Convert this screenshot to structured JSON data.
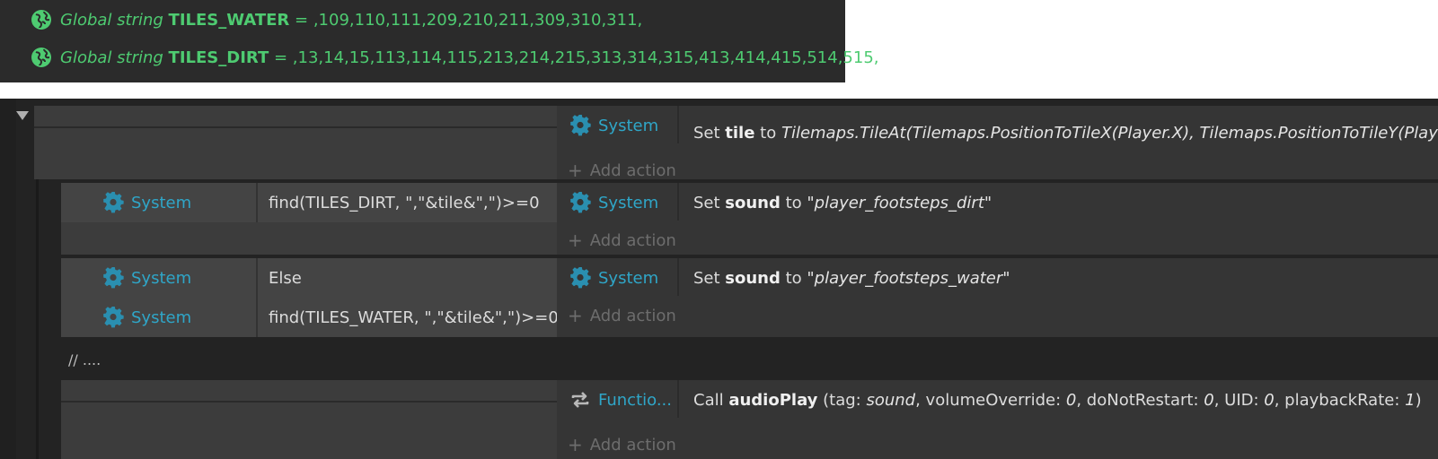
{
  "globals": [
    {
      "kind": "Global string",
      "name": "TILES_WATER",
      "op": "=",
      "value": ",109,110,111,209,210,211,309,310,311,"
    },
    {
      "kind": "Global string",
      "name": "TILES_DIRT",
      "op": "=",
      "value": ",13,14,15,113,114,115,213,214,215,313,314,315,413,414,415,514,515,"
    }
  ],
  "event1": {
    "action": {
      "object": "System",
      "pre": "Set ",
      "var": "tile",
      "mid": " to ",
      "expr": "Tilemaps.TileAt(Tilemaps.PositionToTileX(Player.X), Tilemaps.PositionToTileY(Player.Y))"
    },
    "add_action": "Add action"
  },
  "event2": {
    "condition": {
      "object": "System",
      "text": "find(TILES_DIRT, \",\"&tile&\",\")>=0"
    },
    "action": {
      "object": "System",
      "pre": "Set ",
      "var": "sound",
      "mid": " to ",
      "expr": "\"player_footsteps_dirt\""
    },
    "add_action": "Add action"
  },
  "event3": {
    "conditions": [
      {
        "object": "System",
        "text": "Else"
      },
      {
        "object": "System",
        "text": "find(TILES_WATER, \",\"&tile&\",\")>=0"
      }
    ],
    "action": {
      "object": "System",
      "pre": "Set ",
      "var": "sound",
      "mid": " to ",
      "expr": "\"player_footsteps_water\""
    },
    "add_action": "Add action"
  },
  "comment": "//  ....",
  "event4": {
    "action": {
      "object": "Functio...",
      "pre": "Call ",
      "func": "audioPlay",
      "params_open": " (tag: ",
      "tag": "sound",
      "p2": ", volumeOverride: ",
      "vol": "0",
      "p3": ", doNotRestart: ",
      "dnr": "0",
      "p4": ", UID: ",
      "uid": "0",
      "p5": ", playbackRate: ",
      "rate": "1",
      "close": ")"
    },
    "add_action": "Add action"
  },
  "colors": {
    "global_green": "#4ecb71",
    "system_blue": "#2fa6c8",
    "panel_dark": "#2b2b2b"
  }
}
